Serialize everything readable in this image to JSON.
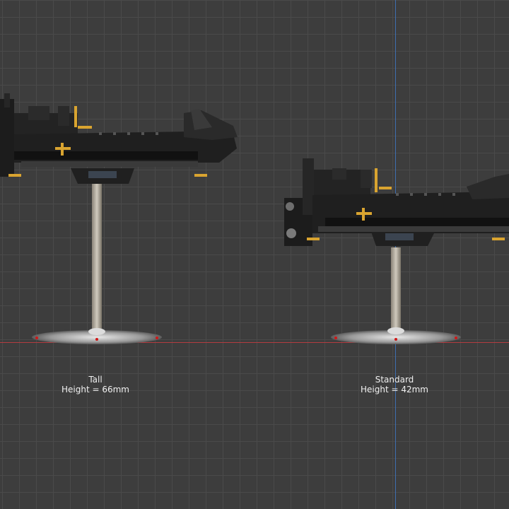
{
  "viewport": {
    "grid": true,
    "colors": {
      "background": "#3d3d3d",
      "grid_line": "#4a4a4a",
      "x_axis": "#b33b40",
      "y_axis": "#3f6fb0",
      "label_text": "#f0f0f0",
      "stand_chrome": "#b8b8b8",
      "hull_dark": "#1f1f1f",
      "brass_accent": "#d9a430",
      "base_marker": "#d01818"
    }
  },
  "models": [
    {
      "name": "Tall",
      "height_text": "Height = 66mm"
    },
    {
      "name": "Standard",
      "height_text": "Height = 42mm"
    }
  ]
}
